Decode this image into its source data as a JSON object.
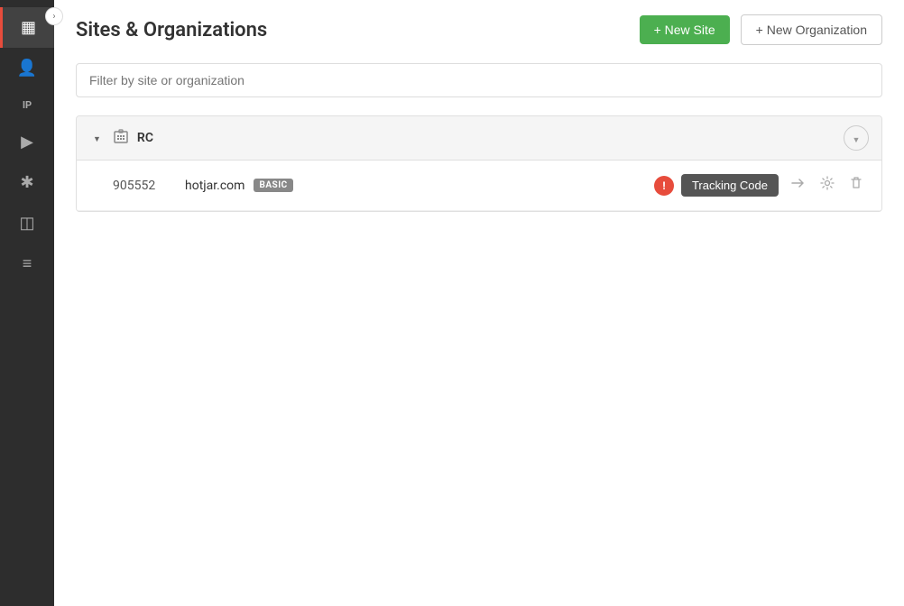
{
  "sidebar": {
    "items": [
      {
        "name": "dashboard",
        "icon": "▦",
        "active": true
      },
      {
        "name": "users",
        "icon": "👤",
        "active": false
      },
      {
        "name": "ip-label",
        "icon": "IP",
        "active": false,
        "text": true
      },
      {
        "name": "recordings",
        "icon": "▶",
        "active": false
      },
      {
        "name": "heatmaps",
        "icon": "✱",
        "active": false
      },
      {
        "name": "funnels",
        "icon": "◫",
        "active": false
      },
      {
        "name": "reports",
        "icon": "≡",
        "active": false
      }
    ],
    "toggle_icon": "›"
  },
  "header": {
    "title": "Sites & Organizations",
    "btn_new_site": "+ New Site",
    "btn_new_org": "+ New Organization"
  },
  "filter": {
    "placeholder": "Filter by site or organization"
  },
  "organization": {
    "name": "RC",
    "sites": [
      {
        "id": "905552",
        "domain": "hotjar.com",
        "plan": "BASIC",
        "warning": true,
        "tracking_code_label": "Tracking Code"
      }
    ]
  }
}
